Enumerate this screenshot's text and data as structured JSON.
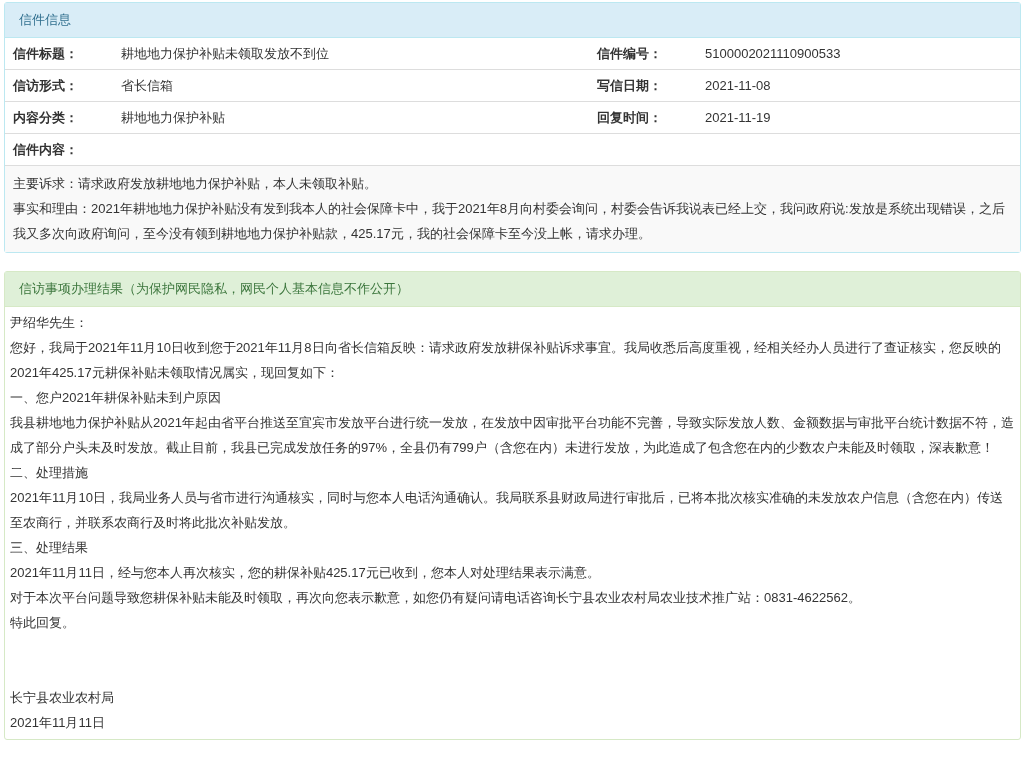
{
  "letter_info": {
    "heading": "信件信息",
    "fields": [
      [
        {
          "label": "信件标题：",
          "value": "耕地地力保护补贴未领取发放不到位"
        },
        {
          "label": "信件编号：",
          "value": "5100002021110900533"
        }
      ],
      [
        {
          "label": "信访形式：",
          "value": "省长信箱"
        },
        {
          "label": "写信日期：",
          "value": "2021-11-08"
        }
      ],
      [
        {
          "label": "内容分类：",
          "value": "耕地地力保护补贴"
        },
        {
          "label": "回复时间：",
          "value": "2021-11-19"
        }
      ]
    ],
    "content_label": "信件内容：",
    "content": [
      "主要诉求：请求政府发放耕地地力保护补贴，本人未领取补贴。",
      "事实和理由：2021年耕地地力保护补贴没有发到我本人的社会保障卡中，我于2021年8月向村委会询问，村委会告诉我说表已经上交，我问政府说:发放是系统出现错误，之后我又多次向政府询问，至今没有领到耕地地力保护补贴款，425.17元，我的社会保障卡至今没上帐，请求办理。"
    ]
  },
  "reply": {
    "heading": "信访事项办理结果（为保护网民隐私，网民个人基本信息不作公开）",
    "paragraphs": [
      "尹绍华先生：",
      "您好，我局于2021年11月10日收到您于2021年11月8日向省长信箱反映：请求政府发放耕保补贴诉求事宜。我局收悉后高度重视，经相关经办人员进行了查证核实，您反映的2021年425.17元耕保补贴未领取情况属实，现回复如下：",
      "一、您户2021年耕保补贴未到户原因",
      "我县耕地地力保护补贴从2021年起由省平台推送至宜宾市发放平台进行统一发放，在发放中因审批平台功能不完善，导致实际发放人数、金额数据与审批平台统计数据不符，造成了部分户头未及时发放。截止目前，我县已完成发放任务的97%，全县仍有799户（含您在内）未进行发放，为此造成了包含您在内的少数农户未能及时领取，深表歉意！",
      "二、处理措施",
      "2021年11月10日，我局业务人员与省市进行沟通核实，同时与您本人电话沟通确认。我局联系县财政局进行审批后，已将本批次核实准确的未发放农户信息（含您在内）传送至农商行，并联系农商行及时将此批次补贴发放。",
      "三、处理结果",
      "2021年11月11日，经与您本人再次核实，您的耕保补贴425.17元已收到，您本人对处理结果表示满意。",
      "对于本次平台问题导致您耕保补贴未能及时领取，再次向您表示歉意，如您仍有疑问请电话咨询长宁县农业农村局农业技术推广站：0831-4622562。",
      "特此回复。"
    ],
    "signature": [
      "长宁县农业农村局",
      "2021年11月11日"
    ]
  }
}
